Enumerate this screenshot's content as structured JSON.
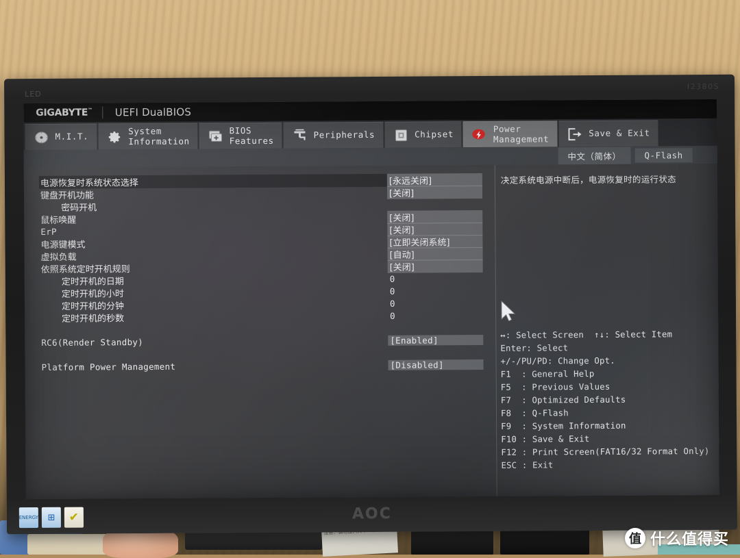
{
  "monitor": {
    "top_left_label": "LED",
    "model_code": "I2380S",
    "brand": "AOC",
    "stickers": [
      {
        "name": "energy-star-sticker",
        "text": "ENERGY"
      },
      {
        "name": "windows-sticker",
        "text": "⊞"
      },
      {
        "name": "certification-sticker",
        "text": "✔"
      }
    ]
  },
  "header": {
    "brand": "GIGABYTE",
    "trademark": "™",
    "title": "UEFI DualBIOS"
  },
  "tabs": [
    {
      "label": "M.I.T.",
      "icon": "gauge-icon",
      "active": false
    },
    {
      "label": "System\nInformation",
      "icon": "gear-icon",
      "active": false
    },
    {
      "label": "BIOS\nFeatures",
      "icon": "bios-chip-icon",
      "active": false
    },
    {
      "label": "Peripherals",
      "icon": "peripherals-icon",
      "active": false
    },
    {
      "label": "Chipset",
      "icon": "chipset-icon",
      "active": false
    },
    {
      "label": "Power\nManagement",
      "icon": "power-lightning-icon",
      "active": true
    },
    {
      "label": "Save & Exit",
      "icon": "exit-arrow-icon",
      "active": false
    }
  ],
  "sub_bar": {
    "language": "中文（简体）",
    "qflash": "Q-Flash"
  },
  "options": [
    {
      "label": "电源恢复时系统状态选择",
      "value": "[永远关闭]",
      "selected": true,
      "boxed": true,
      "indent": 0,
      "mono_label": false,
      "mono_value": false
    },
    {
      "label": "键盘开机功能",
      "value": "[关闭]",
      "selected": false,
      "boxed": true,
      "indent": 0,
      "mono_label": false,
      "mono_value": false
    },
    {
      "label": "密码开机",
      "value": "",
      "selected": false,
      "boxed": false,
      "indent": 1,
      "mono_label": false,
      "mono_value": false
    },
    {
      "label": "鼠标唤醒",
      "value": "[关闭]",
      "selected": false,
      "boxed": true,
      "indent": 0,
      "mono_label": false,
      "mono_value": false
    },
    {
      "label": "ErP",
      "value": "[关闭]",
      "selected": false,
      "boxed": true,
      "indent": 0,
      "mono_label": true,
      "mono_value": false
    },
    {
      "label": "电源键模式",
      "value": "[立即关闭系统]",
      "selected": false,
      "boxed": true,
      "indent": 0,
      "mono_label": false,
      "mono_value": false
    },
    {
      "label": "虚拟负载",
      "value": "[自动]",
      "selected": false,
      "boxed": true,
      "indent": 0,
      "mono_label": false,
      "mono_value": false
    },
    {
      "label": "依照系统定时开机规则",
      "value": "[关闭]",
      "selected": false,
      "boxed": true,
      "indent": 0,
      "mono_label": false,
      "mono_value": false
    },
    {
      "label": "定时开机的日期",
      "value": "0",
      "selected": false,
      "boxed": false,
      "indent": 1,
      "mono_label": false,
      "mono_value": true
    },
    {
      "label": "定时开机的小时",
      "value": "0",
      "selected": false,
      "boxed": false,
      "indent": 1,
      "mono_label": false,
      "mono_value": true
    },
    {
      "label": "定时开机的分钟",
      "value": "0",
      "selected": false,
      "boxed": false,
      "indent": 1,
      "mono_label": false,
      "mono_value": true
    },
    {
      "label": "定时开机的秒数",
      "value": "0",
      "selected": false,
      "boxed": false,
      "indent": 1,
      "mono_label": false,
      "mono_value": true
    },
    {
      "label": "",
      "value": "",
      "selected": false,
      "boxed": false,
      "indent": 0,
      "mono_label": false,
      "mono_value": false
    },
    {
      "label": "RC6(Render Standby)",
      "value": "[Enabled]",
      "selected": false,
      "boxed": true,
      "indent": 0,
      "mono_label": true,
      "mono_value": true
    },
    {
      "label": "",
      "value": "",
      "selected": false,
      "boxed": false,
      "indent": 0,
      "mono_label": false,
      "mono_value": false
    },
    {
      "label": "Platform Power Management",
      "value": "[Disabled]",
      "selected": false,
      "boxed": true,
      "indent": 0,
      "mono_label": true,
      "mono_value": true
    }
  ],
  "help": {
    "text": "决定系统电源中断后，电源恢复时的运行状态"
  },
  "key_legend": [
    "↔: Select Screen  ↑↓: Select Item",
    "Enter: Select",
    "+/-/PU/PD: Change Opt.",
    "F1  : General Help",
    "F5  : Previous Values",
    "F7  : Optimized Defaults",
    "F8  : Q-Flash",
    "F9  : System Information",
    "F10 : Save & Exit",
    "F12 : Print Screen(FAT16/32 Format Only)",
    "ESC : Exit"
  ],
  "watermark": {
    "badge": "值",
    "text": "什么值得买"
  },
  "clutter": {
    "label_text": "注意：请勿投入火中"
  },
  "colors": {
    "accent_red": "#d82a2a",
    "screen_base": "#42444a",
    "tab_active": "#c4c6c8",
    "text": "#eceeef"
  }
}
